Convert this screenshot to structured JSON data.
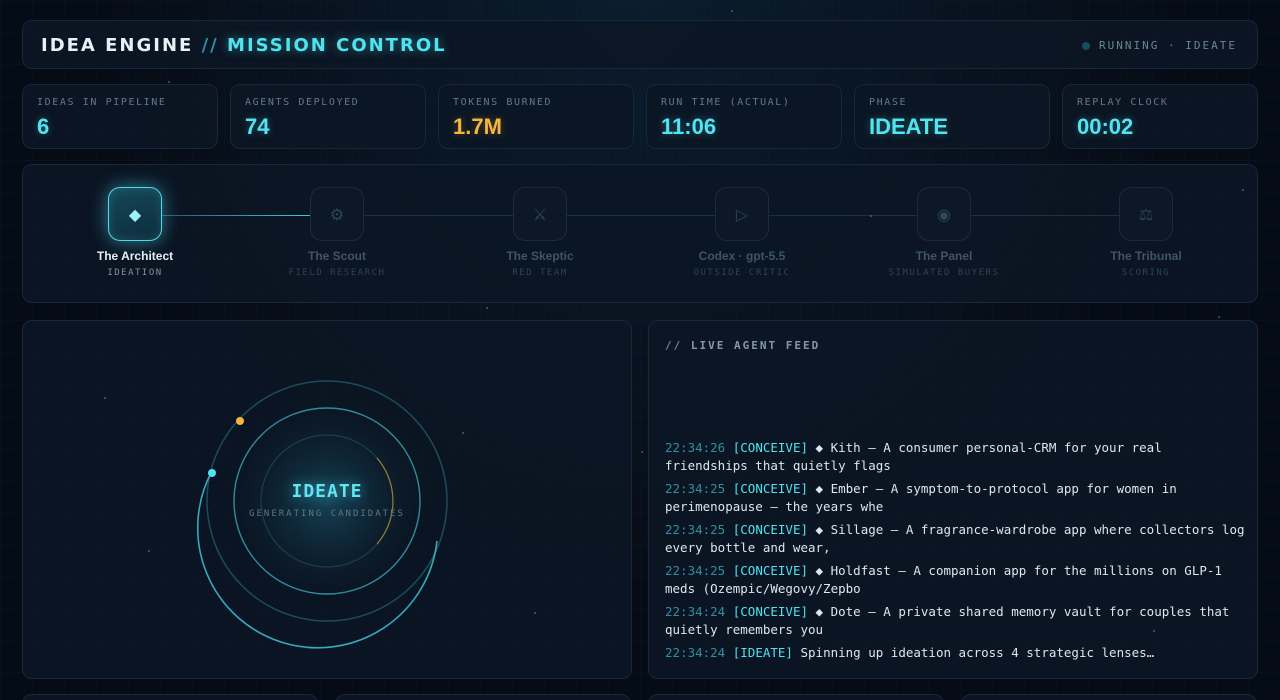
{
  "header": {
    "title_main": "IDEA ENGINE",
    "title_sep": "//",
    "title_sub": "MISSION CONTROL",
    "status": "RUNNING · IDEATE"
  },
  "stats": [
    {
      "label": "IDEAS IN PIPELINE",
      "value": "6",
      "color": "#52e4f2"
    },
    {
      "label": "AGENTS DEPLOYED",
      "value": "74",
      "color": "#52e4f2"
    },
    {
      "label": "TOKENS BURNED",
      "value": "1.7M",
      "color": "#f7b63b"
    },
    {
      "label": "RUN TIME (ACTUAL)",
      "value": "11:06",
      "color": "#52e4f2"
    },
    {
      "label": "PHASE",
      "value": "IDEATE",
      "color": "#52e4f2"
    },
    {
      "label": "REPLAY CLOCK",
      "value": "00:02",
      "color": "#52e4f2"
    }
  ],
  "pipeline": {
    "stages": [
      {
        "name": "The Architect",
        "role": "IDEATION",
        "icon": "diamond-icon",
        "glyph": "◆",
        "active": true
      },
      {
        "name": "The Scout",
        "role": "FIELD RESEARCH",
        "icon": "gear-icon",
        "glyph": "⚙",
        "active": false
      },
      {
        "name": "The Skeptic",
        "role": "RED TEAM",
        "icon": "crossed-swords-icon",
        "glyph": "⚔",
        "active": false
      },
      {
        "name": "Codex · gpt-5.5",
        "role": "OUTSIDE CRITIC",
        "icon": "play-circle-icon",
        "glyph": "▷",
        "active": false
      },
      {
        "name": "The Panel",
        "role": "SIMULATED BUYERS",
        "icon": "target-icon",
        "glyph": "◉",
        "active": false
      },
      {
        "name": "The Tribunal",
        "role": "SCORING",
        "icon": "scales-icon",
        "glyph": "⚖",
        "active": false
      }
    ]
  },
  "orbit": {
    "phase": "IDEATE",
    "caption": "GENERATING CANDIDATES"
  },
  "feed": {
    "title_prefix": "//",
    "title": "LIVE AGENT FEED",
    "entries": [
      {
        "time": "22:34:26",
        "tag": "[CONCEIVE]",
        "text": "◆ Kith — A consumer personal-CRM for your real friendships that quietly flags"
      },
      {
        "time": "22:34:25",
        "tag": "[CONCEIVE]",
        "text": "◆ Ember — A symptom-to-protocol app for women in perimenopause — the years whe"
      },
      {
        "time": "22:34:25",
        "tag": "[CONCEIVE]",
        "text": "◆ Sillage — A fragrance-wardrobe app where collectors log every bottle and wear,"
      },
      {
        "time": "22:34:25",
        "tag": "[CONCEIVE]",
        "text": "◆ Holdfast — A companion app for the millions on GLP-1 meds (Ozempic/Wegovy/Zepbo"
      },
      {
        "time": "22:34:24",
        "tag": "[CONCEIVE]",
        "text": "◆ Dote — A private shared memory vault for couples that quietly remembers you"
      },
      {
        "time": "22:34:24",
        "tag": "[IDEATE]",
        "text": "Spinning up ideation across 4 strategic lenses…"
      }
    ]
  },
  "colors": {
    "accent": "#4fe3f0",
    "amber": "#f7b63b",
    "background": "#060c16"
  }
}
